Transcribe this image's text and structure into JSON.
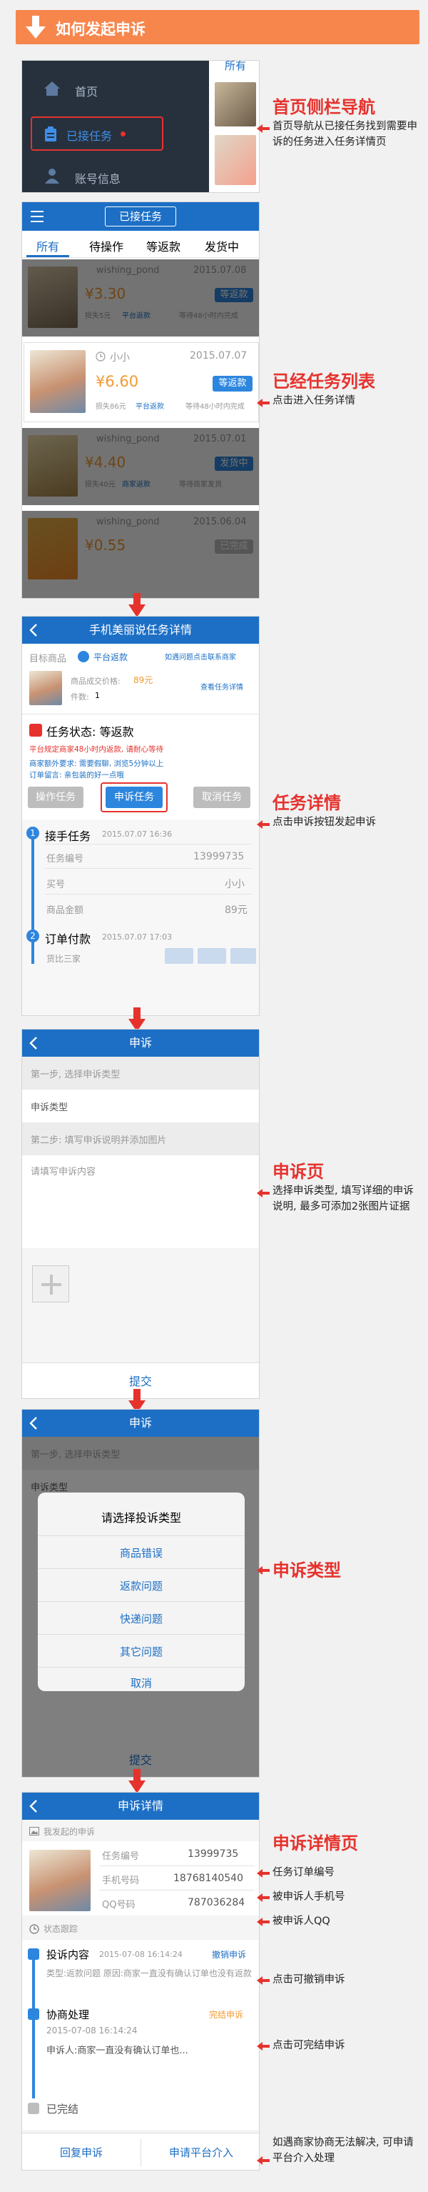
{
  "header": {
    "title": "如何发起申诉"
  },
  "s1": {
    "menu": [
      "首页",
      "已接任务",
      "账号信息"
    ],
    "tab_peek": "所有",
    "annot_title": "首页侧栏导航",
    "annot_desc": "首页导航从已接任务找到需要申诉的任务进入任务详情页"
  },
  "s2": {
    "title": "已接任务",
    "tabs": [
      "所有",
      "待操作",
      "等返款",
      "发货中"
    ],
    "cards": [
      {
        "shop": "wishing_pond",
        "date": "2015.07.08",
        "price": "¥3.30",
        "status": "等返款",
        "meta1": "损失5元",
        "meta2": "平台返款",
        "meta3": "等待48小时内完成"
      },
      {
        "shop": "小小",
        "date": "2015.07.07",
        "price": "¥6.60",
        "status": "等返款",
        "meta1": "损失86元",
        "meta2": "平台返款",
        "meta3": "等待48小时内完成"
      },
      {
        "shop": "wishing_pond",
        "date": "2015.07.01",
        "price": "¥4.40",
        "status": "发货中",
        "meta1": "损失40元",
        "meta2": "商家返款",
        "meta3": "等待商家发货"
      },
      {
        "shop": "wishing_pond",
        "date": "2015.06.04",
        "price": "¥0.55",
        "status": "已完成",
        "meta1": "",
        "meta2": "",
        "meta3": ""
      }
    ],
    "annot_title": "已经任务列表",
    "annot_desc": "点击进入任务详情"
  },
  "s3": {
    "title": "手机美丽说任务详情",
    "label_target": "目标商品",
    "platform_tag": "平台返款",
    "contact_hint": "如遇问题点击联系商家",
    "price_label": "商品成交价格:",
    "price_value": "89元",
    "qty_label": "件数:",
    "qty_value": "1",
    "view_detail": "查看任务详情",
    "status_label": "任务状态: 等返款",
    "status_red": "平台规定商家48小时内返款, 请耐心等待",
    "extra_line1": "商家额外要求: 需要假聊, 浏览5分钟以上",
    "extra_line2": "订单留言: 亲包装的好一点哦",
    "buttons": [
      "操作任务",
      "申诉任务",
      "取消任务"
    ],
    "step1_title": "接手任务",
    "step1_time": "2015.07.07 16:36",
    "fields": [
      {
        "k": "任务编号",
        "v": "13999735"
      },
      {
        "k": "买号",
        "v": "小小"
      },
      {
        "k": "商品金额",
        "v": "89元"
      }
    ],
    "step2_title": "订单付款",
    "step2_time": "2015.07.07 17:03",
    "step2_sub": "货比三家",
    "annot_title": "任务详情",
    "annot_desc": "点击申诉按钮发起申诉"
  },
  "s4": {
    "title": "申诉",
    "step1": "第一步, 选择申诉类型",
    "type_label": "申诉类型",
    "step2": "第二步: 填写申诉说明并添加图片",
    "placeholder": "请填写申诉内容",
    "submit": "提交",
    "annot_title": "申诉页",
    "annot_desc": "选择申诉类型, 填写详细的申诉说明, 最多可添加2张图片证据"
  },
  "s5": {
    "title": "申诉",
    "modal_title": "请选择投诉类型",
    "options": [
      "商品错误",
      "返款问题",
      "快递问题",
      "其它问题",
      "取消"
    ],
    "bg_step1": "第一步, 选择申诉类型",
    "bg_type": "申诉类型",
    "bg_submit": "提交",
    "annot_title": "申诉类型"
  },
  "s6": {
    "title": "申诉详情",
    "mine_label": "我发起的申诉",
    "fields": [
      {
        "k": "任务编号",
        "v": "13999735"
      },
      {
        "k": "手机号码",
        "v": "18768140540"
      },
      {
        "k": "QQ号码",
        "v": "787036284"
      }
    ],
    "status_label": "状态跟踪",
    "t1_title": "投诉内容",
    "t1_time": "2015-07-08 16:14:24",
    "t1_action": "撤销申诉",
    "t1_desc": "类型:返款问题 原因:商家一直没有确认订单也没有返款",
    "t2_title": "协商处理",
    "t2_action": "完结申诉",
    "t2_time": "2015-07-08 16:14:24",
    "t2_desc": "申诉人:商家一直没有确认订单也...",
    "t3_title": "已完结",
    "btn_reply": "回复申诉",
    "btn_platform": "申请平台介入",
    "annot_title": "申诉详情页",
    "annot_items": [
      "任务订单编号",
      "被申诉人手机号",
      "被申诉人QQ",
      "点击可撤销申诉",
      "点击可完结申诉"
    ],
    "annot_last": "如遇商家协商无法解决, 可申请平台介入处理"
  }
}
